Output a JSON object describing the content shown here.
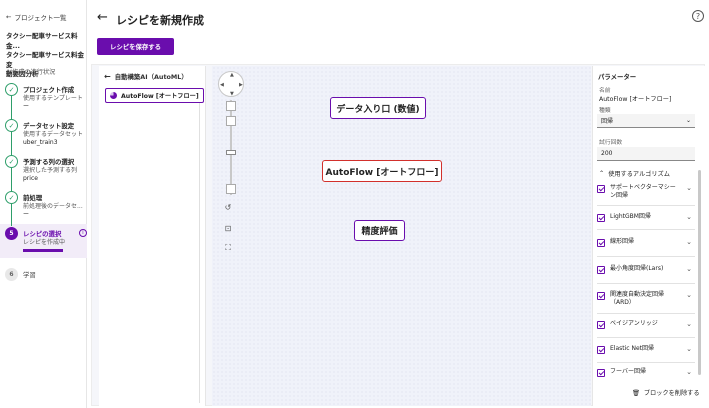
{
  "sidebar": {
    "back_label": "プロジェクト一覧",
    "project_name_line1": "タクシー配車サービス料金...",
    "project_name_line2": "タクシー配車サービス料金変",
    "project_name_line3": "動要因分析",
    "flow_title": "AI作成の進行状況",
    "steps": [
      {
        "title": "プロジェクト作成",
        "sub": "使用するテンプレート",
        "value": "ー"
      },
      {
        "title": "データセット設定",
        "sub": "使用するデータセット",
        "value": "uber_train3"
      },
      {
        "title": "予測する列の選択",
        "sub": "選択した予測する列",
        "value": "price"
      },
      {
        "title": "前処理",
        "sub": "前処理後のデータセ...",
        "value": "ー"
      },
      {
        "number": "5",
        "title": "レシピの選択",
        "sub": "レシピを作成中",
        "info": "i"
      },
      {
        "number": "6",
        "title": "学習"
      }
    ]
  },
  "header": {
    "title": "レシピを新規作成",
    "save_label": "レシピを保存する",
    "help": "?"
  },
  "block_list": {
    "header": "自動構築AI（AutoML）",
    "item": "AutoFlow [オートフロー]"
  },
  "canvas": {
    "nodes": [
      {
        "label": "データ入り口 (数値)"
      },
      {
        "label": "AutoFlow [オートフロー]"
      },
      {
        "label": "精度評価"
      }
    ]
  },
  "params": {
    "title": "パラメーター",
    "name_label": "名前",
    "name_value": "AutoFlow [オートフロー]",
    "type_label": "種類",
    "type_value": "回帰",
    "trials_label": "試行回数",
    "trials_value": "200",
    "algo_header": "使用するアルゴリズム",
    "algorithms": [
      "サポートベクターマシーン回帰",
      "LightGBM回帰",
      "線形回帰",
      "最小角度回帰(Lars)",
      "関連度自動決定回帰（ARD）",
      "ベイジアンリッジ",
      "Elastic Net回帰",
      "フーバー回帰"
    ],
    "delete_label": "ブロックを削除する"
  },
  "colors": {
    "accent": "#6a0dad",
    "done": "#2e9e6a",
    "selected_border": "#d2302c"
  }
}
